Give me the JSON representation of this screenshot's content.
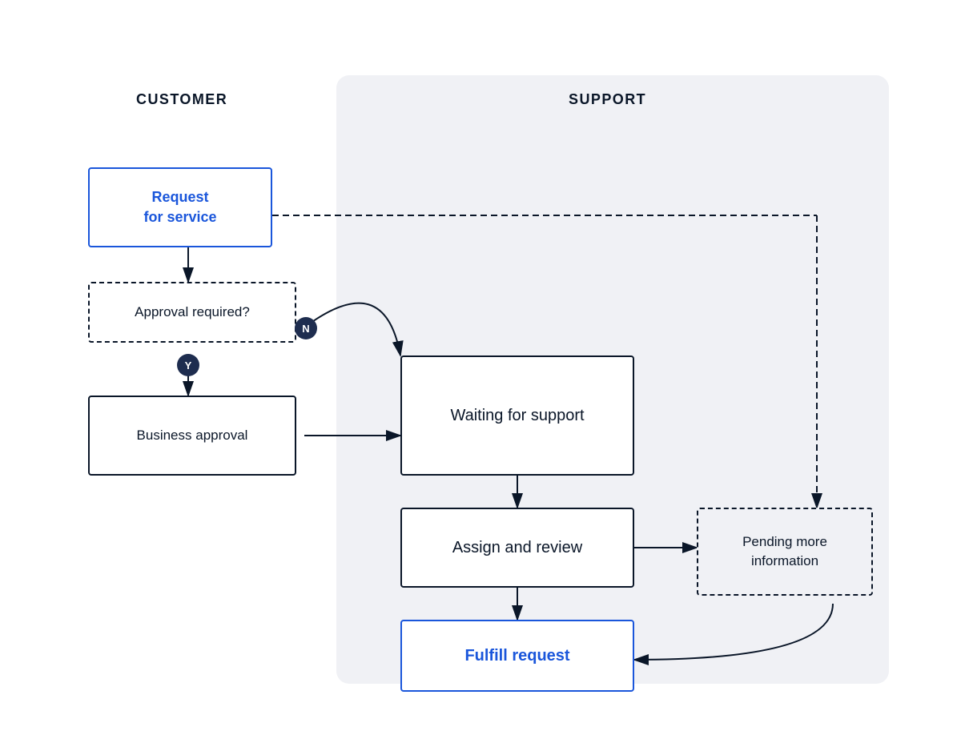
{
  "diagram": {
    "columns": {
      "customer": "CUSTOMER",
      "support": "SUPPORT"
    },
    "boxes": {
      "request_service": "Request\nfor service",
      "approval_required": "Approval required?",
      "business_approval": "Business approval",
      "waiting_support": "Waiting for support",
      "assign_review": "Assign and review",
      "fulfill_request": "Fulfill request",
      "pending_info": "Pending more\ninformation"
    },
    "badges": {
      "n": "N",
      "y": "Y"
    }
  }
}
